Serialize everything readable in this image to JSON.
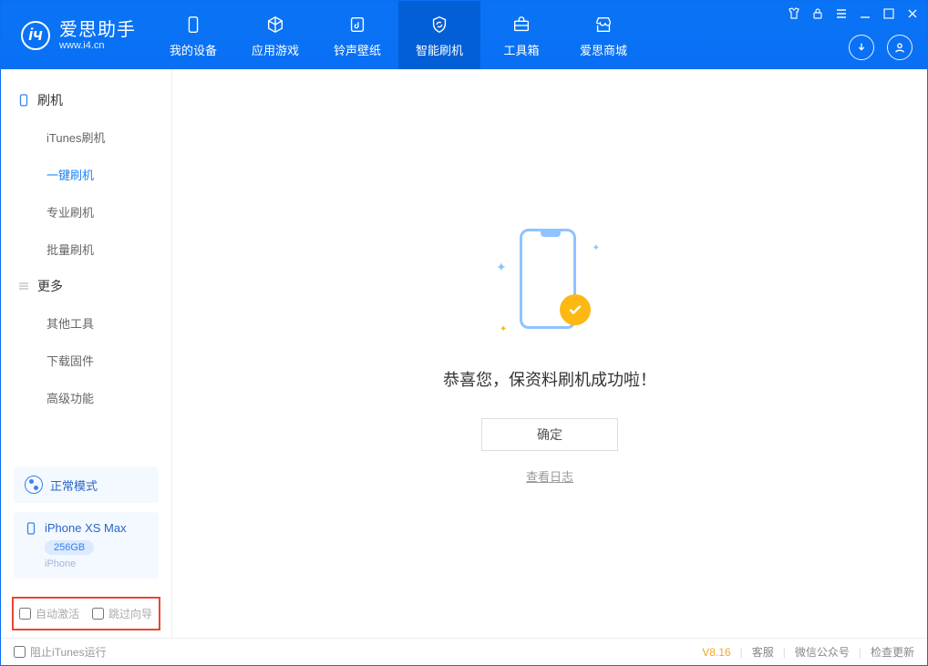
{
  "app": {
    "name": "爱思助手",
    "url": "www.i4.cn"
  },
  "header_tabs": [
    {
      "label": "我的设备"
    },
    {
      "label": "应用游戏"
    },
    {
      "label": "铃声壁纸"
    },
    {
      "label": "智能刷机"
    },
    {
      "label": "工具箱"
    },
    {
      "label": "爱思商城"
    }
  ],
  "sidebar": {
    "group1_title": "刷机",
    "group1_items": [
      "iTunes刷机",
      "一键刷机",
      "专业刷机",
      "批量刷机"
    ],
    "group2_title": "更多",
    "group2_items": [
      "其他工具",
      "下载固件",
      "高级功能"
    ]
  },
  "status": {
    "mode": "正常模式"
  },
  "device": {
    "name": "iPhone XS Max",
    "capacity": "256GB",
    "type": "iPhone"
  },
  "options": {
    "auto_activate": "自动激活",
    "skip_guide": "跳过向导"
  },
  "main": {
    "message": "恭喜您，保资料刷机成功啦！",
    "ok": "确定",
    "view_log": "查看日志"
  },
  "footer": {
    "block_itunes": "阻止iTunes运行",
    "version": "V8.16",
    "support": "客服",
    "wechat": "微信公众号",
    "check_update": "检查更新"
  }
}
